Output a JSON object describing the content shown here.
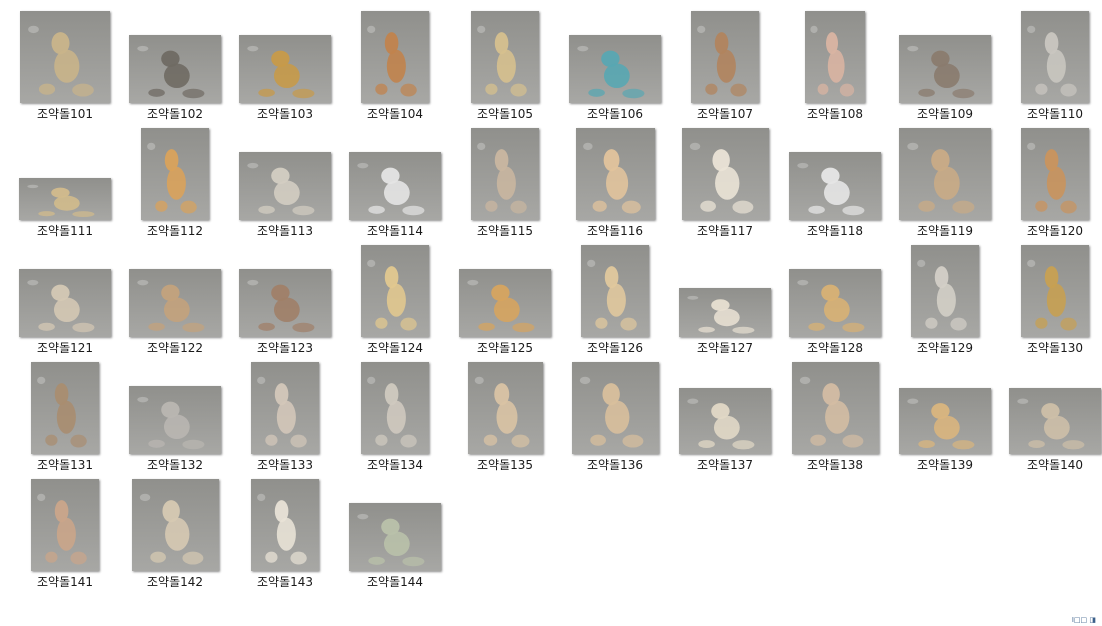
{
  "files": [
    {
      "label": "조약돌101",
      "bg": "#8a8a86",
      "fg": "#c9b48a",
      "ratio": 0.98,
      "icon": "pebble-figure-art-icon"
    },
    {
      "label": "조약돌102",
      "bg": "#b7b0a4",
      "fg": "#6f6a63",
      "ratio": 1.36,
      "icon": "pebble-kiss-art-icon"
    },
    {
      "label": "조약돌103",
      "bg": "#3f8e9a",
      "fg": "#c79a49",
      "ratio": 1.36,
      "icon": "pebble-dogs-art-icon"
    },
    {
      "label": "조약돌104",
      "bg": "#6fa9c9",
      "fg": "#c1834d",
      "ratio": 0.74,
      "icon": "pebble-couple-art-icon"
    },
    {
      "label": "조약돌105",
      "bg": "#4fa1a6",
      "fg": "#d6c08e",
      "ratio": 0.74,
      "icon": "pebble-couple-art-icon"
    },
    {
      "label": "조약돌106",
      "bg": "#1f58a8",
      "fg": "#58a7b2",
      "ratio": 1.36,
      "icon": "pebble-whales-art-icon"
    },
    {
      "label": "조약돌107",
      "bg": "#9bb3cc",
      "fg": "#b1845e",
      "ratio": 0.74,
      "icon": "pebble-woman-art-icon"
    },
    {
      "label": "조약돌108",
      "bg": "#9cc1e1",
      "fg": "#d9b4a2",
      "ratio": 0.65,
      "icon": "pebble-flamingo-art-icon"
    },
    {
      "label": "조약돌109",
      "bg": "#cfcac1",
      "fg": "#8a7b6e",
      "ratio": 1.36,
      "icon": "pebble-bird-art-icon"
    },
    {
      "label": "조약돌110",
      "bg": "#2a5f84",
      "fg": "#c9c6c0",
      "ratio": 0.74,
      "icon": "pebble-spider-art-icon"
    },
    {
      "label": "조약돌111",
      "bg": "#2e6d8e",
      "fg": "#d2bb8c",
      "ratio": 2.2,
      "icon": "pebble-owl-art-icon"
    },
    {
      "label": "조약돌112",
      "bg": "#2c8b7e",
      "fg": "#d9a25b",
      "ratio": 0.74,
      "icon": "pebble-giraffe-art-icon"
    },
    {
      "label": "조약돌113",
      "bg": "#545450",
      "fg": "#d3cdc2",
      "ratio": 1.36,
      "icon": "pebble-crab-art-icon"
    },
    {
      "label": "조약돌114",
      "bg": "#2e67ae",
      "fg": "#e4e4e4",
      "ratio": 1.36,
      "icon": "pebble-fish-art-icon"
    },
    {
      "label": "조약돌115",
      "bg": "#3c4e56",
      "fg": "#c9b6a0",
      "ratio": 0.74,
      "icon": "pebble-wave-art-icon"
    },
    {
      "label": "조약돌116",
      "bg": "#7c8a86",
      "fg": "#e1c39c",
      "ratio": 0.86,
      "icon": "pebble-dancer-art-icon"
    },
    {
      "label": "조약돌117",
      "bg": "#7b5a4e",
      "fg": "#eae3d6",
      "ratio": 0.95,
      "icon": "pebble-woman-art-icon"
    },
    {
      "label": "조약돌118",
      "bg": "#2f74b8",
      "fg": "#e6e6e6",
      "ratio": 1.36,
      "icon": "pebble-whale-art-icon"
    },
    {
      "label": "조약돌119",
      "bg": "#4c5a66",
      "fg": "#c9ab86",
      "ratio": 1.0,
      "icon": "pebble-fish-art-icon"
    },
    {
      "label": "조약돌120",
      "bg": "#1f5aa6",
      "fg": "#c9935d",
      "ratio": 0.74,
      "icon": "pebble-seahorse-art-icon"
    },
    {
      "label": "조약돌121",
      "bg": "#3f7fb5",
      "fg": "#d4c8b4",
      "ratio": 1.36,
      "icon": "pebble-sharks-art-icon"
    },
    {
      "label": "조약돌122",
      "bg": "#7f8a94",
      "fg": "#c3a27c",
      "ratio": 1.36,
      "icon": "pebble-turtle-art-icon"
    },
    {
      "label": "조약돌123",
      "bg": "#4ea2c2",
      "fg": "#a07f68",
      "ratio": 1.36,
      "icon": "pebble-beach-art-icon"
    },
    {
      "label": "조약돌124",
      "bg": "#7eb1cc",
      "fg": "#e1c88f",
      "ratio": 0.74,
      "icon": "pebble-sailboat-art-icon"
    },
    {
      "label": "조약돌125",
      "bg": "#27649c",
      "fg": "#d6a45f",
      "ratio": 1.36,
      "icon": "pebble-dog-art-icon"
    },
    {
      "label": "조약돌126",
      "bg": "#2b6fb0",
      "fg": "#e0c89d",
      "ratio": 0.74,
      "icon": "pebble-cat-art-icon"
    },
    {
      "label": "조약돌127",
      "bg": "#3e8396",
      "fg": "#e7dfd1",
      "ratio": 1.86,
      "icon": "pebble-animals-art-icon"
    },
    {
      "label": "조약돌128",
      "bg": "#5a7fa1",
      "fg": "#d8b174",
      "ratio": 1.36,
      "icon": "pebble-lion-art-icon"
    },
    {
      "label": "조약돌129",
      "bg": "#7c6a5c",
      "fg": "#d3cfc7",
      "ratio": 0.74,
      "icon": "pebble-toucan-art-icon"
    },
    {
      "label": "조약돌130",
      "bg": "#7ba0a5",
      "fg": "#c7a052",
      "ratio": 0.74,
      "icon": "pebble-giraffe-art-icon"
    },
    {
      "label": "조약돌131",
      "bg": "#a7acae",
      "fg": "#a98d70",
      "ratio": 0.74,
      "icon": "pebble-owl-art-icon"
    },
    {
      "label": "조약돌132",
      "bg": "#3ea699",
      "fg": "#b9b6b1",
      "ratio": 1.36,
      "icon": "pebble-dragonfly-art-icon"
    },
    {
      "label": "조약돌133",
      "bg": "#3b7dbb",
      "fg": "#d3c7b9",
      "ratio": 0.74,
      "icon": "pebble-fisherman-art-icon"
    },
    {
      "label": "조약돌134",
      "bg": "#2f6f6d",
      "fg": "#cfc9bf",
      "ratio": 0.74,
      "icon": "pebble-elephant-art-icon"
    },
    {
      "label": "조약돌135",
      "bg": "#3a6fb5",
      "fg": "#d9c3a4",
      "ratio": 0.82,
      "icon": "pebble-man-art-icon"
    },
    {
      "label": "조약돌136",
      "bg": "#406f9f",
      "fg": "#d8bf9c",
      "ratio": 0.95,
      "icon": "pebble-pyramid-art-icon"
    },
    {
      "label": "조약돌137",
      "bg": "#3d6893",
      "fg": "#e1d8c6",
      "ratio": 1.4,
      "icon": "pebble-scooter-art-icon"
    },
    {
      "label": "조약돌138",
      "bg": "#5c9abf",
      "fg": "#d3bca3",
      "ratio": 0.95,
      "icon": "pebble-couple-dog-art-icon"
    },
    {
      "label": "조약돌139",
      "bg": "#3f6b9c",
      "fg": "#d9b57e",
      "ratio": 1.4,
      "icon": "pebble-dancers-art-icon"
    },
    {
      "label": "조약돌140",
      "bg": "#4a5a66",
      "fg": "#cdbfa8",
      "ratio": 1.4,
      "icon": "pebble-motorcycle-art-icon"
    },
    {
      "label": "조약돌141",
      "bg": "#4f9ca0",
      "fg": "#caa58a",
      "ratio": 0.74,
      "icon": "pebble-bodybuilder-art-icon"
    },
    {
      "label": "조약돌142",
      "bg": "#464542",
      "fg": "#d6c9b2",
      "ratio": 0.95,
      "icon": "pebble-scream-art-icon"
    },
    {
      "label": "조약돌143",
      "bg": "#7f8c94",
      "fg": "#e8e2d6",
      "ratio": 0.74,
      "icon": "pebble-marilyn-art-icon"
    },
    {
      "label": "조약돌144",
      "bg": "#2b4d3f",
      "fg": "#b9c1aa",
      "ratio": 1.36,
      "icon": "pebble-crocodile-photo-icon"
    }
  ],
  "footer": {
    "corner_text": "Ι□□ ◨"
  }
}
